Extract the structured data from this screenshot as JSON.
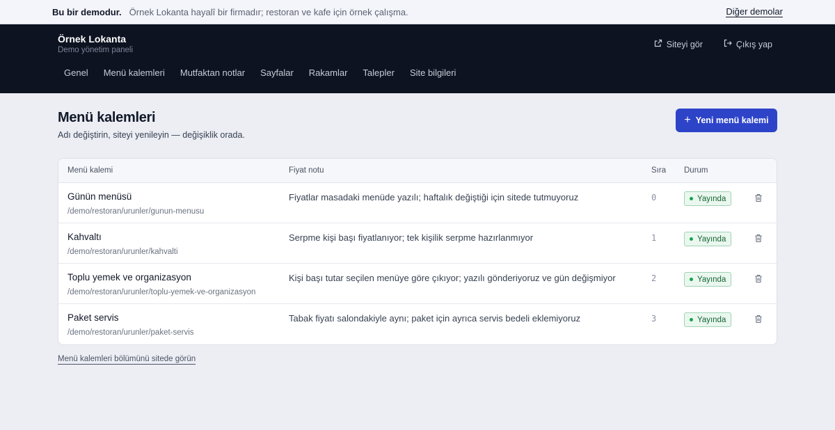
{
  "banner": {
    "title": "Bu bir demodur.",
    "text": "Örnek Lokanta hayalî bir firmadır; restoran ve kafe için örnek çalışma.",
    "link": "Diğer demolar"
  },
  "header": {
    "brand_name": "Örnek Lokanta",
    "brand_sub": "Demo yönetim paneli",
    "view_site": "Siteyi gör",
    "logout": "Çıkış yap",
    "nav": [
      "Genel",
      "Menü kalemleri",
      "Mutfaktan notlar",
      "Sayfalar",
      "Rakamlar",
      "Talepler",
      "Site bilgileri"
    ]
  },
  "page": {
    "title": "Menü kalemleri",
    "description": "Adı değiştirin, siteyi yenileyin — değişiklik orada.",
    "new_button": "Yeni menü kalemi",
    "footer_link": "Menü kalemleri bölümünü sitede görün"
  },
  "table": {
    "headers": {
      "item": "Menü kalemi",
      "price_note": "Fiyat notu",
      "order": "Sıra",
      "status": "Durum"
    },
    "rows": [
      {
        "title": "Günün menüsü",
        "path": "/demo/restoran/urunler/gunun-menusu",
        "note": "Fiyatlar masadaki menüde yazılı; haftalık değiştiği için sitede tutmuyoruz",
        "order": "0",
        "status": "Yayında"
      },
      {
        "title": "Kahvaltı",
        "path": "/demo/restoran/urunler/kahvalti",
        "note": "Serpme kişi başı fiyatlanıyor; tek kişilik serpme hazırlanmıyor",
        "order": "1",
        "status": "Yayında"
      },
      {
        "title": "Toplu yemek ve organizasyon",
        "path": "/demo/restoran/urunler/toplu-yemek-ve-organizasyon",
        "note": "Kişi başı tutar seçilen menüye göre çıkıyor; yazılı gönderiyoruz ve gün değişmiyor",
        "order": "2",
        "status": "Yayında"
      },
      {
        "title": "Paket servis",
        "path": "/demo/restoran/urunler/paket-servis",
        "note": "Tabak fiyatı salondakiyle aynı; paket için ayrıca servis bedeli eklemiyoruz",
        "order": "3",
        "status": "Yayında"
      }
    ]
  },
  "colors": {
    "accent": "#2d44c9",
    "header_bg": "#0d1321",
    "status_green": "#16a34a"
  }
}
